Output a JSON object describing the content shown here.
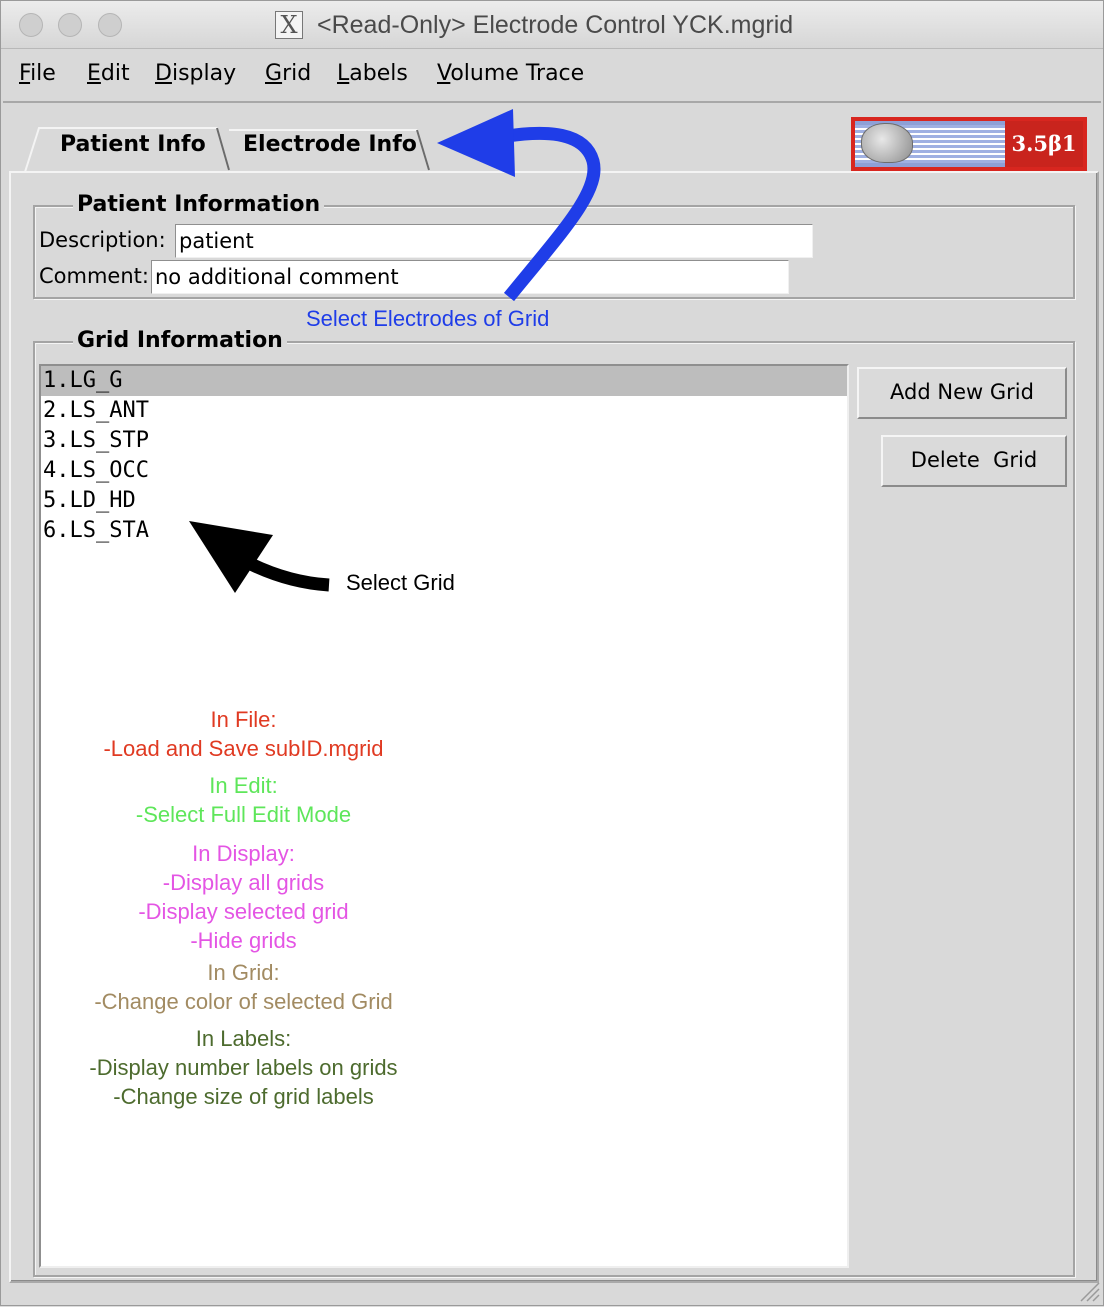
{
  "window": {
    "title": "<Read-Only> Electrode Control YCK.mgrid",
    "title_icon_glyph": "X"
  },
  "menubar": {
    "items": [
      {
        "mnemonic": "F",
        "rest": "ile"
      },
      {
        "mnemonic": "E",
        "rest": "dit"
      },
      {
        "mnemonic": "D",
        "rest": "isplay"
      },
      {
        "mnemonic": "G",
        "rest": "rid"
      },
      {
        "mnemonic": "L",
        "rest": "abels"
      },
      {
        "mnemonic": "V",
        "rest": "olume Trace"
      }
    ]
  },
  "tabs": [
    {
      "label": "Patient Info",
      "active": true
    },
    {
      "label": "Electrode Info",
      "active": false
    }
  ],
  "logo": {
    "version": "3.5β1"
  },
  "patient_info": {
    "group_title": "Patient Information",
    "description_label": "Description:",
    "description_value": "patient",
    "comment_label": "Comment:",
    "comment_value": "no additional comment"
  },
  "grid_info": {
    "group_title": "Grid Information",
    "grids": [
      "1.LG_G",
      "2.LS_ANT",
      "3.LS_STP",
      "4.LS_OCC",
      "5.LD_HD",
      "6.LS_STA"
    ],
    "selected_index": 0,
    "add_button": "Add New Grid",
    "delete_button": "Delete  Grid"
  },
  "annotations": {
    "select_electrodes": "Select Electrodes of Grid",
    "select_grid": "Select Grid",
    "colors": {
      "blue": "#1f3de8",
      "file": "#e03a22",
      "edit": "#5ee65a",
      "display": "#e455e4",
      "grid": "#a28b62",
      "labels": "#4d6b2e"
    },
    "notes": {
      "file": [
        "In File:",
        "-Load and Save subID.mgrid"
      ],
      "edit": [
        "In Edit:",
        "-Select Full Edit Mode"
      ],
      "display": [
        "In Display:",
        "-Display all grids",
        "-Display selected grid",
        "-Hide grids"
      ],
      "grid": [
        "In Grid:",
        "-Change color of selected Grid"
      ],
      "labels": [
        "In Labels:",
        "-Display number labels on grids",
        "-Change size of grid labels"
      ]
    }
  }
}
